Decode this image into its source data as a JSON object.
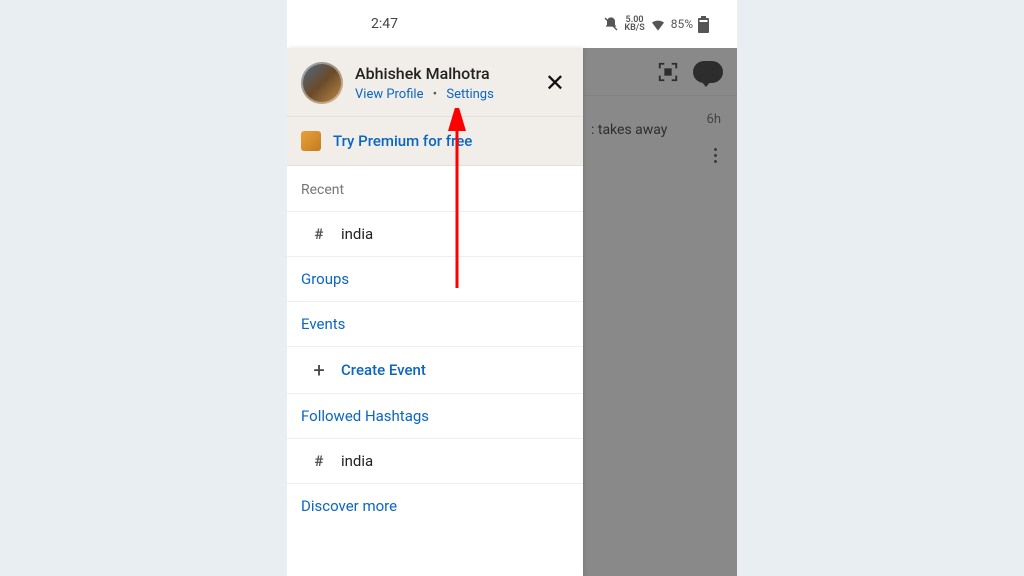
{
  "status": {
    "time": "2:47",
    "speed_top": "5.00",
    "speed_bottom": "KB/S",
    "battery": "85%"
  },
  "background": {
    "feed_snippet": ": takes away",
    "feed_time": "6h"
  },
  "drawer": {
    "profile": {
      "name": "Abhishek Malhotra",
      "view_profile": "View Profile",
      "settings": "Settings"
    },
    "premium": "Try Premium for free",
    "recent_header": "Recent",
    "recent_item": "india",
    "groups": "Groups",
    "events": "Events",
    "create_event": "Create Event",
    "followed_header": "Followed Hashtags",
    "followed_item": "india",
    "discover": "Discover more"
  }
}
